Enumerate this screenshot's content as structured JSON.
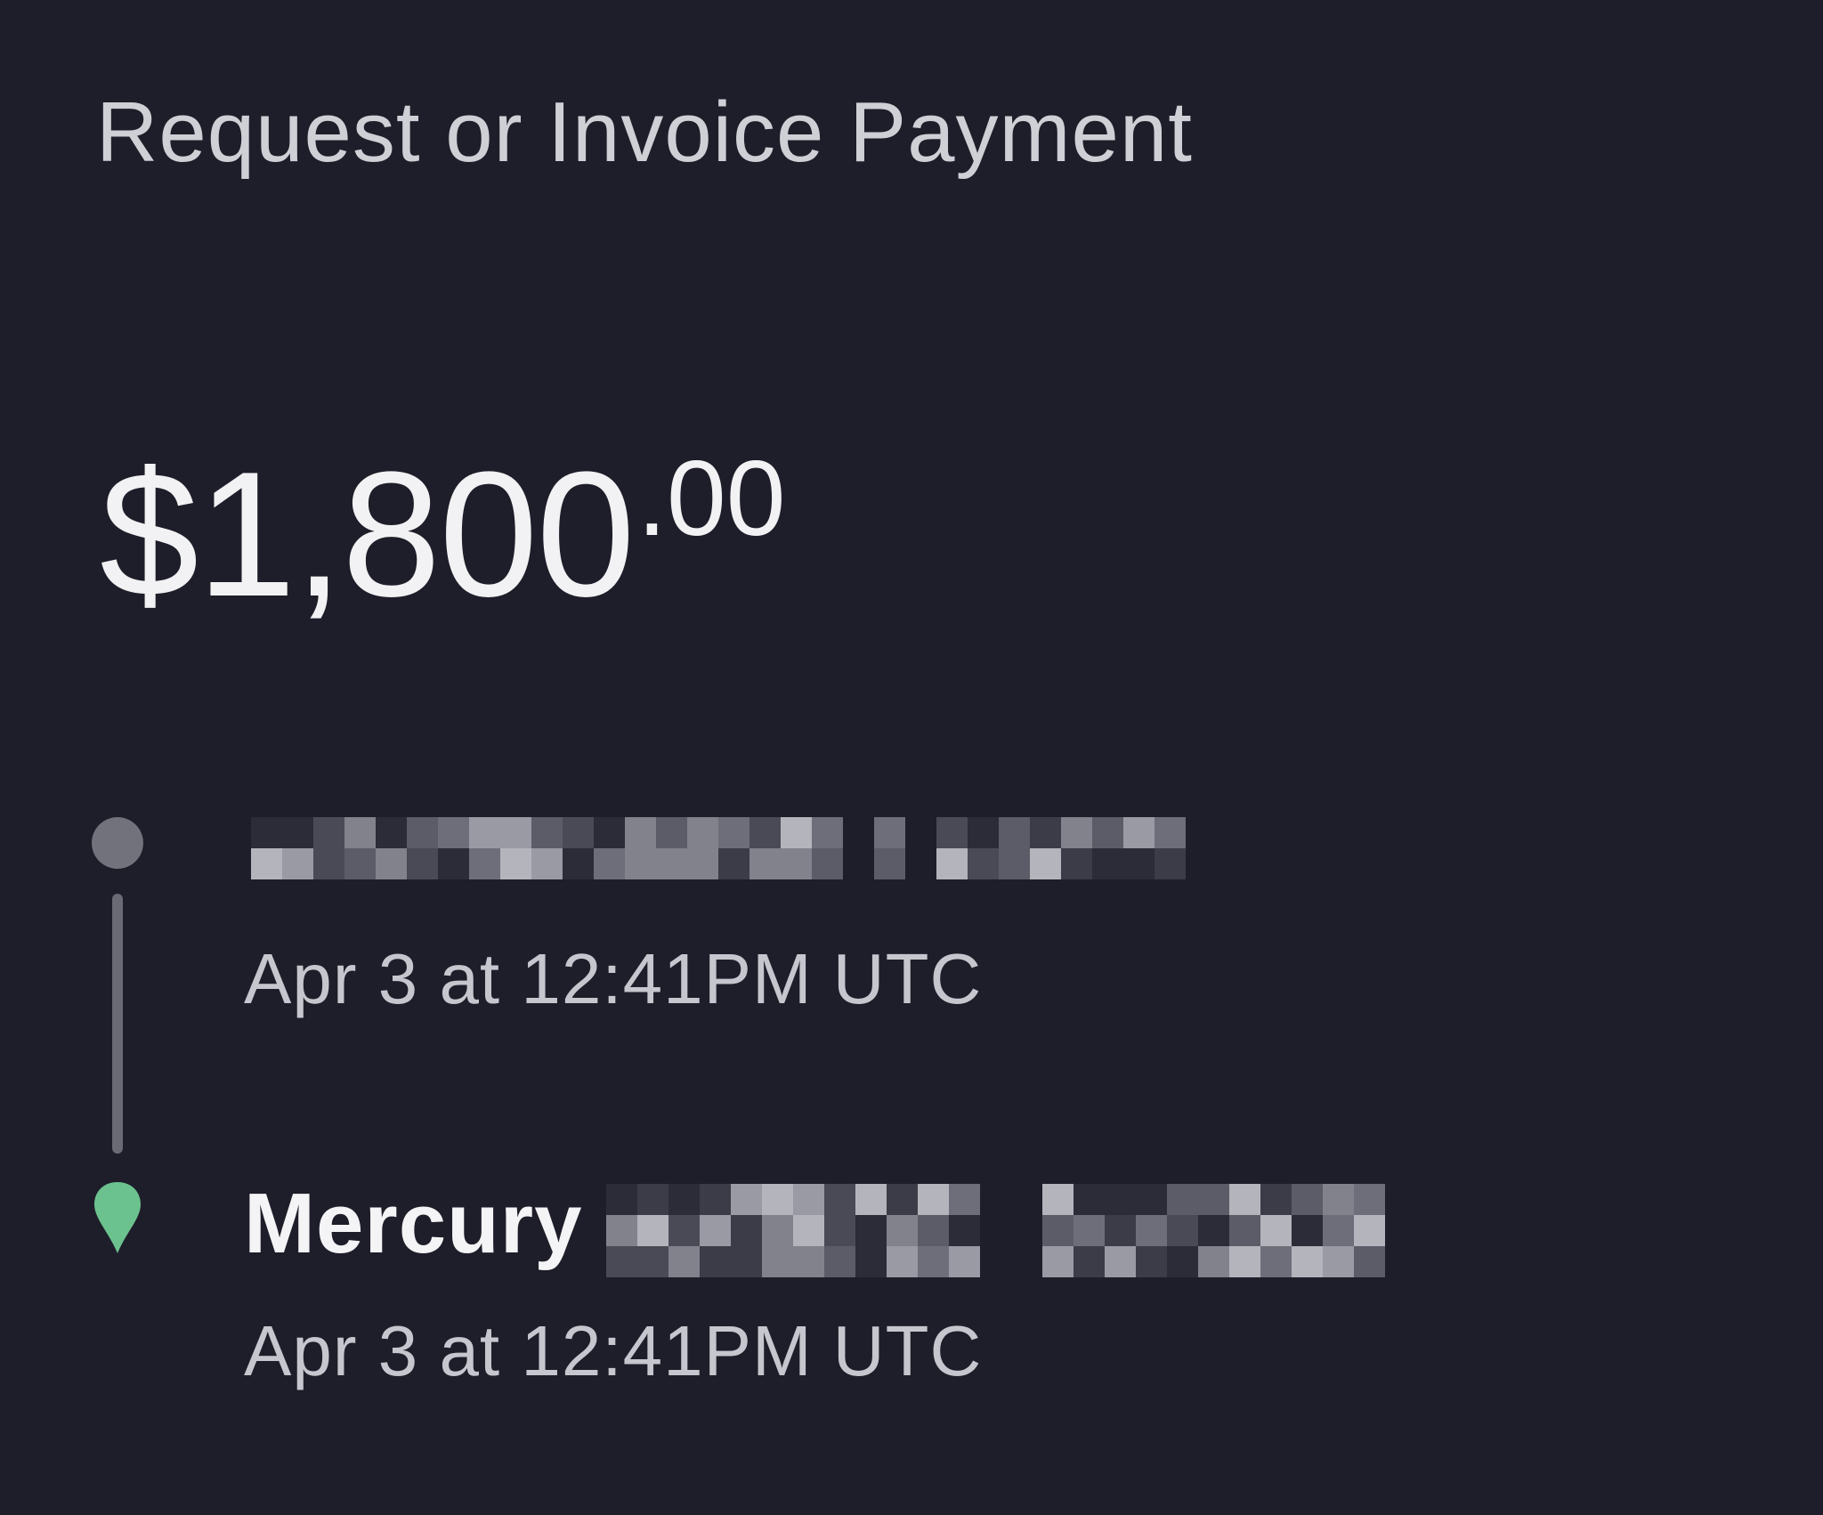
{
  "header": {
    "title": "Request or Invoice Payment"
  },
  "payment": {
    "amount_main": "$1,800",
    "amount_cents": ".00"
  },
  "timeline": {
    "events": [
      {
        "label": "",
        "label_redacted": true,
        "timestamp": "Apr 3 at 12:41PM UTC",
        "marker_icon": "dot-icon",
        "marker_color": "#72727c"
      },
      {
        "label": "Mercury",
        "label_redacted_suffix": true,
        "timestamp": "Apr 3 at 12:41PM UTC",
        "marker_icon": "location-pin-icon",
        "marker_color": "#6cc28e"
      }
    ]
  },
  "colors": {
    "background": "#1e1e2a",
    "accent": "#6cc28e",
    "muted": "#72727c"
  }
}
